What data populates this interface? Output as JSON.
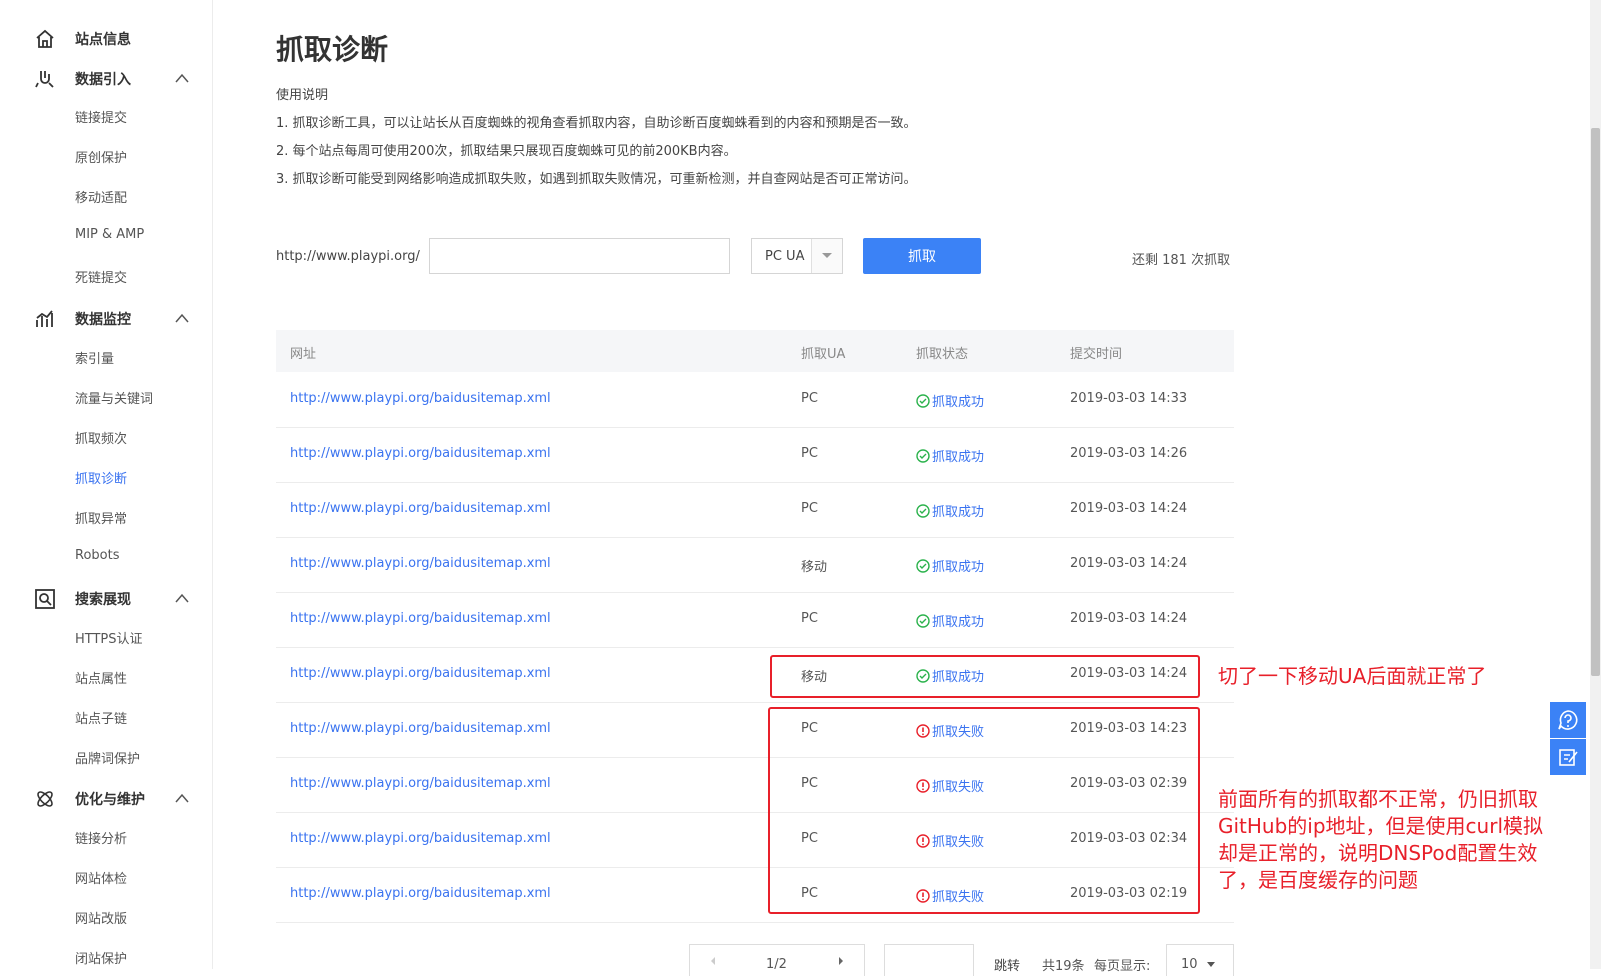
{
  "sidebar": {
    "site_info": "站点信息",
    "groups": [
      {
        "label": "数据引入",
        "items": [
          "链接提交",
          "原创保护",
          "移动适配",
          "MIP & AMP",
          "死链提交"
        ]
      },
      {
        "label": "数据监控",
        "items": [
          "索引量",
          "流量与关键词",
          "抓取频次",
          "抓取诊断",
          "抓取异常",
          "Robots"
        ]
      },
      {
        "label": "搜索展现",
        "items": [
          "HTTPS认证",
          "站点属性",
          "站点子链",
          "品牌词保护"
        ]
      },
      {
        "label": "优化与维护",
        "items": [
          "链接分析",
          "网站体检",
          "网站改版",
          "闭站保护"
        ]
      }
    ],
    "active_item": "抓取诊断"
  },
  "page": {
    "title": "抓取诊断",
    "instructions_title": "使用说明",
    "instructions": [
      "1. 抓取诊断工具，可以让站长从百度蜘蛛的视角查看抓取内容，自助诊断百度蜘蛛看到的内容和预期是否一致。",
      "2. 每个站点每周可使用200次，抓取结果只展现百度蜘蛛可见的前200KB内容。",
      "3. 抓取诊断可能受到网络影响造成抓取失败，如遇到抓取失败情况，可重新检测，并自查网站是否可正常访问。"
    ]
  },
  "form": {
    "domain_prefix": "http://www.playpi.org/",
    "url_value": "",
    "ua_selected": "PC UA",
    "fetch_label": "抓取",
    "remaining": "还剩 181 次抓取"
  },
  "table": {
    "headers": [
      "网址",
      "抓取UA",
      "抓取状态",
      "提交时间"
    ],
    "rows": [
      {
        "url": "http://www.playpi.org/baidusitemap.xml",
        "ua": "PC",
        "status": "抓取成功",
        "ok": true,
        "time": "2019-03-03 14:33"
      },
      {
        "url": "http://www.playpi.org/baidusitemap.xml",
        "ua": "PC",
        "status": "抓取成功",
        "ok": true,
        "time": "2019-03-03 14:26"
      },
      {
        "url": "http://www.playpi.org/baidusitemap.xml",
        "ua": "PC",
        "status": "抓取成功",
        "ok": true,
        "time": "2019-03-03 14:24"
      },
      {
        "url": "http://www.playpi.org/baidusitemap.xml",
        "ua": "移动",
        "status": "抓取成功",
        "ok": true,
        "time": "2019-03-03 14:24"
      },
      {
        "url": "http://www.playpi.org/baidusitemap.xml",
        "ua": "PC",
        "status": "抓取成功",
        "ok": true,
        "time": "2019-03-03 14:24"
      },
      {
        "url": "http://www.playpi.org/baidusitemap.xml",
        "ua": "移动",
        "status": "抓取成功",
        "ok": true,
        "time": "2019-03-03 14:24"
      },
      {
        "url": "http://www.playpi.org/baidusitemap.xml",
        "ua": "PC",
        "status": "抓取失败",
        "ok": false,
        "time": "2019-03-03 14:23"
      },
      {
        "url": "http://www.playpi.org/baidusitemap.xml",
        "ua": "PC",
        "status": "抓取失败",
        "ok": false,
        "time": "2019-03-03 02:39"
      },
      {
        "url": "http://www.playpi.org/baidusitemap.xml",
        "ua": "PC",
        "status": "抓取失败",
        "ok": false,
        "time": "2019-03-03 02:34"
      },
      {
        "url": "http://www.playpi.org/baidusitemap.xml",
        "ua": "PC",
        "status": "抓取失败",
        "ok": false,
        "time": "2019-03-03 02:19"
      }
    ]
  },
  "pagination": {
    "page": "1/2",
    "jump_label": "跳转",
    "total": "共19条",
    "per_page_label": "每页显示:",
    "per_page_value": "10"
  },
  "annotations": {
    "note1": "切了一下移动UA后面就正常了",
    "note2": [
      "前面所有的抓取都不正常，仍旧抓取",
      "GitHub的ip地址，但是使用curl模拟",
      "却是正常的，说明DNSPod配置生效",
      "了，是百度缓存的问题"
    ]
  },
  "colors": {
    "accent": "#3b82f6",
    "link": "#3a73f0",
    "success": "#2bb24c",
    "fail": "#e8202a",
    "annotation": "#e8202a"
  },
  "icons": {
    "site_info": "home-icon",
    "group_icons": [
      "import-icon",
      "chart-icon",
      "search-display-icon",
      "atom-icon"
    ],
    "float": [
      "help-icon",
      "feedback-icon"
    ]
  }
}
